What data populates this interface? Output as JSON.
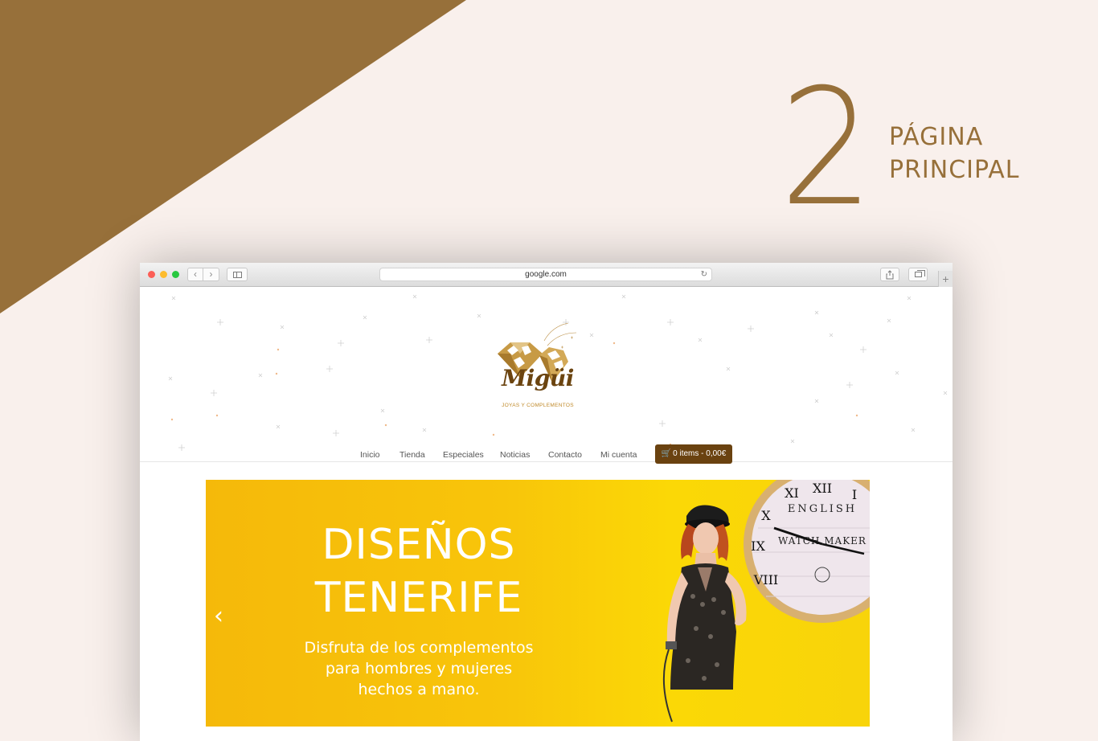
{
  "slide": {
    "step_number": "2",
    "title_line1": "PÁGINA",
    "title_line2": "PRINCIPAL"
  },
  "browser": {
    "url": "google.com",
    "new_tab_symbol": "+"
  },
  "site": {
    "logo_name": "Migüi",
    "logo_tagline": "JOYAS Y COMPLEMENTOS",
    "nav": [
      "Inicio",
      "Tienda",
      "Especiales",
      "Noticias",
      "Contacto",
      "Mi cuenta"
    ],
    "cart_label": "0 items - 0,00€"
  },
  "hero": {
    "title_line1": "DISEÑOS",
    "title_line2": "TENERIFE",
    "subtitle_line1": "Disfruta de los complementos",
    "subtitle_line2": "para hombres y mujeres",
    "subtitle_line3": "hechos a mano.",
    "prev_symbol": "‹",
    "clock_line1": "ENGLISH",
    "clock_line2": "WATCH MAKER"
  },
  "colors": {
    "accent_brown": "#97703a",
    "cart_brown": "#6a4210",
    "hero_yellow": "#f8c50a",
    "background": "#f9f0ec"
  }
}
